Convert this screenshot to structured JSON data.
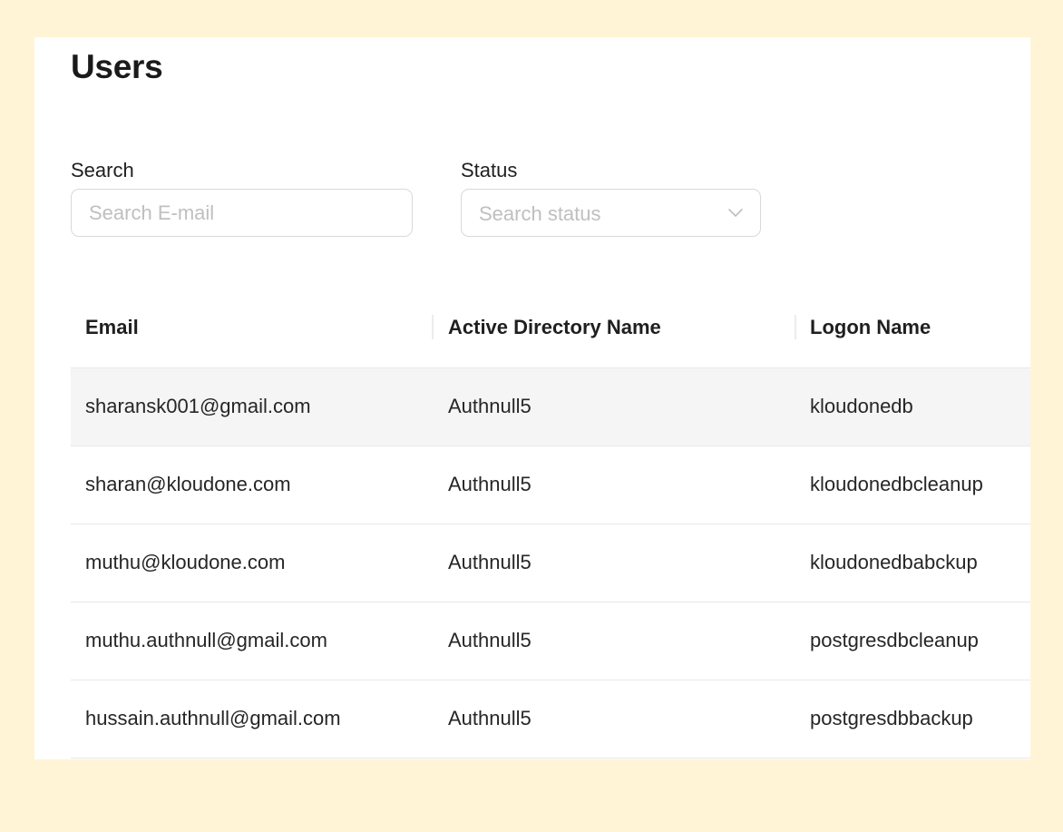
{
  "page": {
    "title": "Users"
  },
  "filters": {
    "search_label": "Search",
    "search_placeholder": "Search E-mail",
    "search_value": "",
    "status_label": "Status",
    "status_placeholder": "Search status",
    "status_icon": "chevron-down-icon"
  },
  "table": {
    "headers": {
      "email": "Email",
      "ad_name": "Active Directory Name",
      "logon_name": "Logon Name"
    },
    "rows": [
      {
        "email": "sharansk001@gmail.com",
        "ad_name": "Authnull5",
        "logon_name": "kloudonedb",
        "hovered": true
      },
      {
        "email": "sharan@kloudone.com",
        "ad_name": "Authnull5",
        "logon_name": "kloudonedbcleanup"
      },
      {
        "email": "muthu@kloudone.com",
        "ad_name": "Authnull5",
        "logon_name": "kloudonedbabckup"
      },
      {
        "email": "muthu.authnull@gmail.com",
        "ad_name": "Authnull5",
        "logon_name": "postgresdbcleanup"
      },
      {
        "email": "hussain.authnull@gmail.com",
        "ad_name": "Authnull5",
        "logon_name": "postgresdbbackup"
      }
    ]
  },
  "colors": {
    "backdrop": "#fff4d6",
    "panel": "#ffffff",
    "border": "#d9d9d9",
    "placeholder": "#bfbfbf",
    "row_hover": "#f5f5f5"
  }
}
